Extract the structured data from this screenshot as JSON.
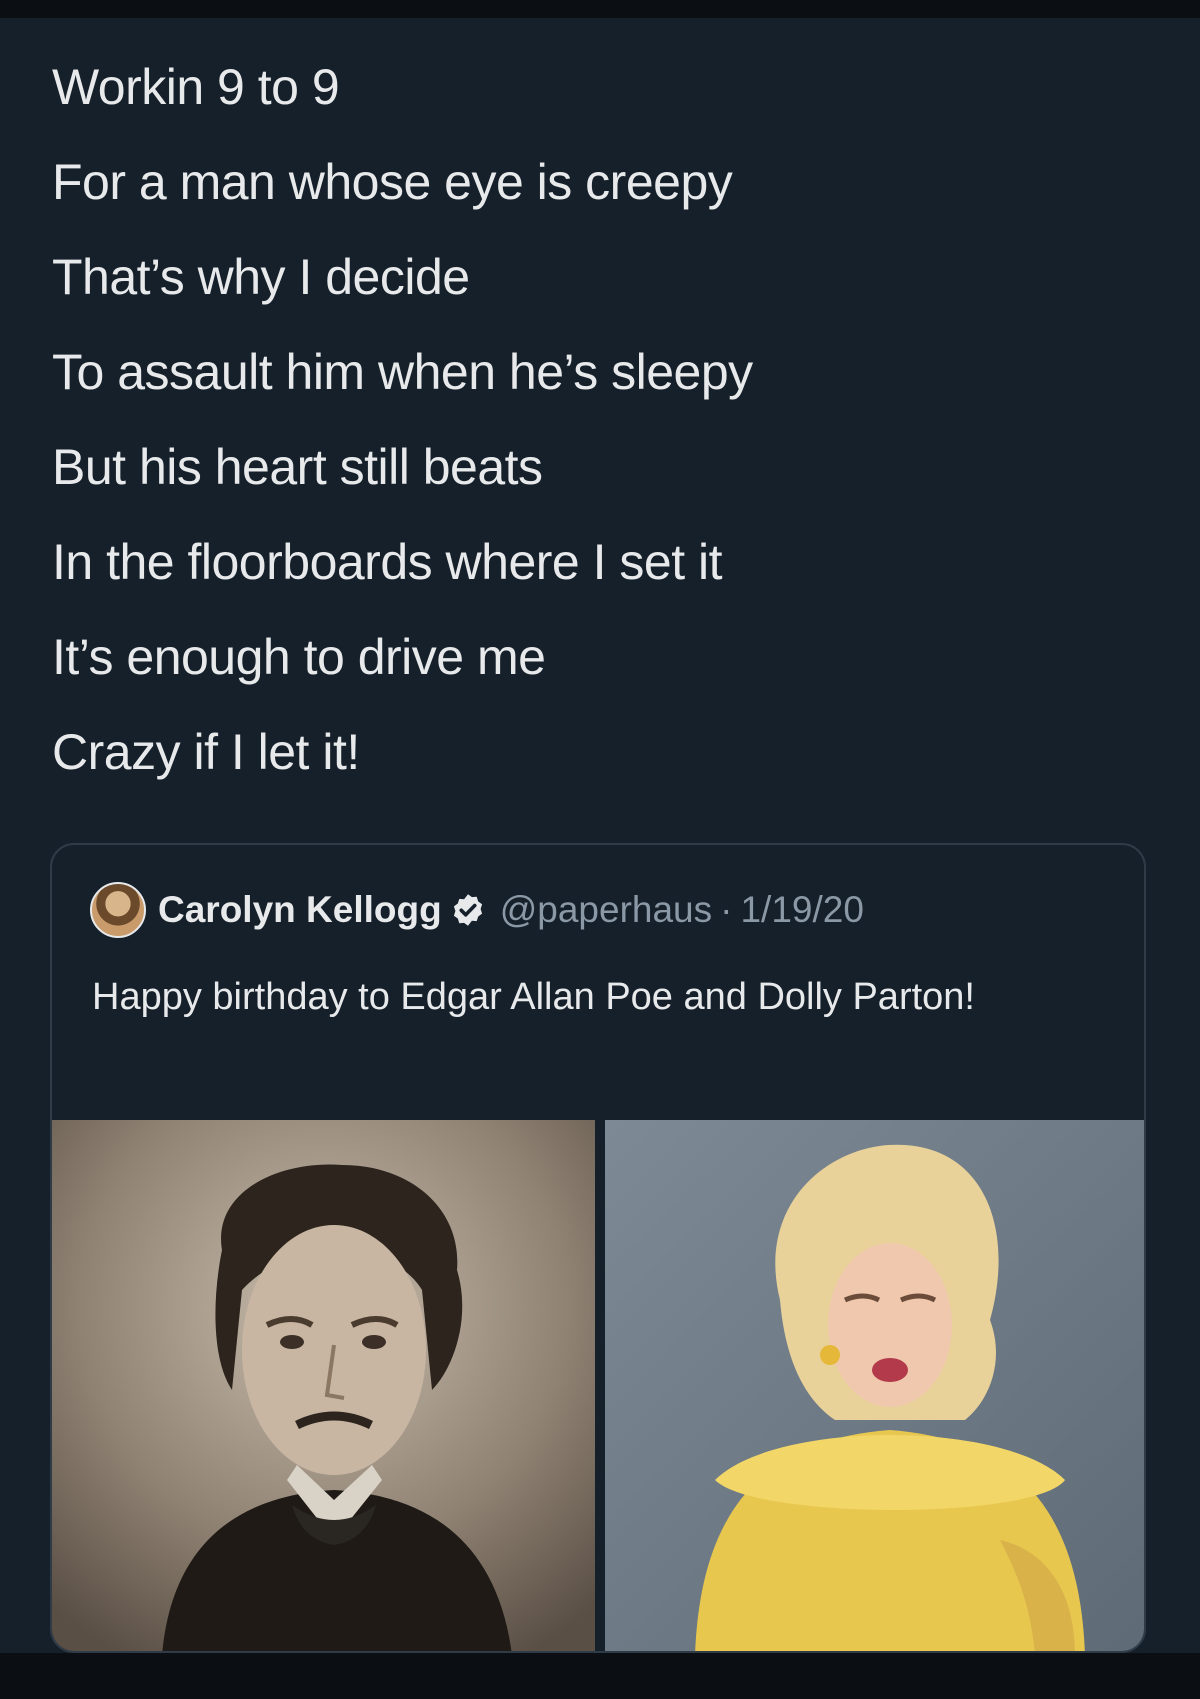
{
  "poem": {
    "lines": [
      "Workin 9 to 9",
      "For a man whose eye is creepy",
      "That’s why I decide",
      "To assault him when he’s sleepy",
      "But his heart still beats",
      "In the floorboards where I set it",
      "It’s enough to drive me",
      "Crazy if I let it!"
    ]
  },
  "quoted_tweet": {
    "display_name": "Carolyn Kellogg",
    "verified_icon": "verified-badge-icon",
    "handle": "@paperhaus",
    "separator": "·",
    "date": "1/19/20",
    "text": "Happy birthday to Edgar Allan Poe and Dolly Parton!",
    "media": [
      {
        "icon": "portrait-photo-poe"
      },
      {
        "icon": "portrait-photo-parton"
      }
    ]
  },
  "colors": {
    "background": "#15202b",
    "text": "#e7e9ea",
    "secondary_text": "#8b98a5",
    "card_border": "#2f3b47"
  }
}
